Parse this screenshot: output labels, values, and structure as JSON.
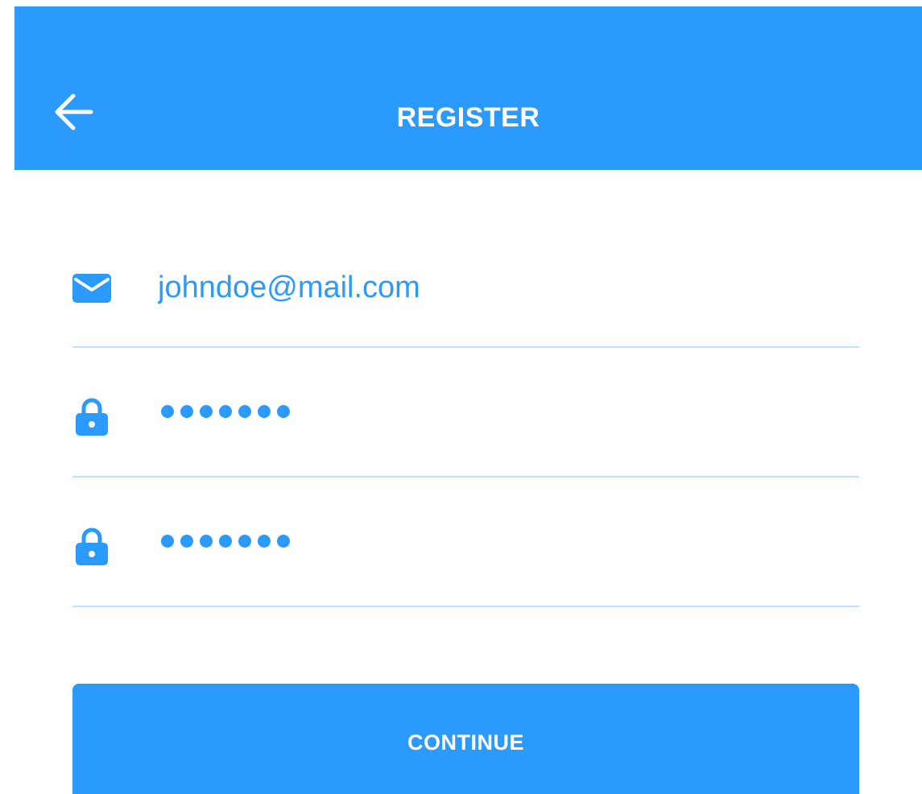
{
  "header": {
    "title": "REGISTER",
    "back_icon": "arrow-left-icon"
  },
  "form": {
    "email": {
      "icon": "envelope-icon",
      "value": "johndoe@mail.com"
    },
    "password": {
      "icon": "lock-icon",
      "masked_length": 7
    },
    "confirm_password": {
      "icon": "lock-icon",
      "masked_length": 7
    }
  },
  "actions": {
    "continue_label": "CONTINUE"
  },
  "colors": {
    "primary": "#2A9BFD",
    "divider": "#BFE0FC",
    "on_primary": "#FFFFFF",
    "background": "#FFFFFF"
  }
}
